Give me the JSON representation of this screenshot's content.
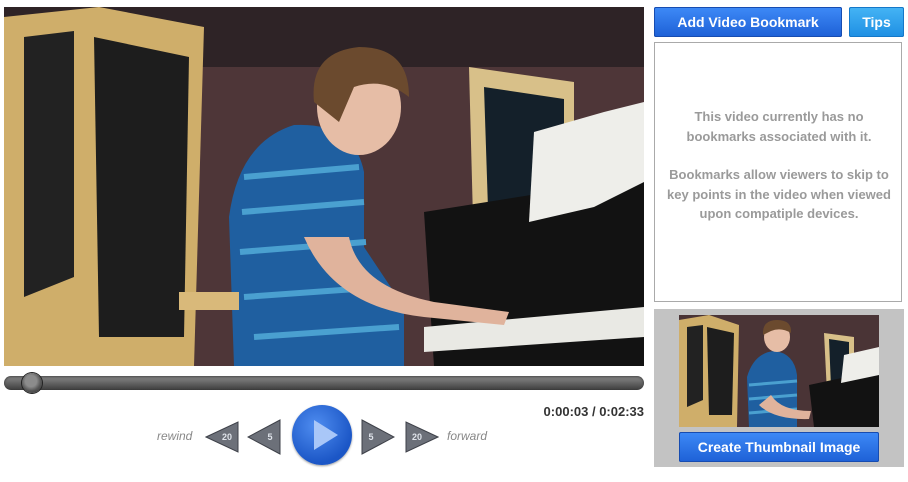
{
  "toolbar": {
    "add_bookmark_label": "Add Video Bookmark",
    "tips_label": "Tips"
  },
  "bookmarks": {
    "empty_message_line1": "This video currently has no bookmarks associated with it.",
    "empty_message_line2": "Bookmarks allow viewers to skip to key points in the video when viewed upon compatiple devices."
  },
  "thumbnail": {
    "create_label": "Create Thumbnail Image"
  },
  "player": {
    "progress_fraction": 0.02,
    "current_time": "0:00:03",
    "duration": "0:02:33",
    "time_display": "0:00:03 / 0:02:33",
    "rewind_label": "rewind",
    "forward_label": "forward",
    "rewind_20": "20",
    "rewind_5": "5",
    "forward_5": "5",
    "forward_20": "20"
  },
  "icons": {
    "play": "play-icon",
    "rewind": "rewind-triangle-icon",
    "forward": "forward-triangle-icon"
  },
  "colors": {
    "button_blue": "#1d60d6",
    "button_light_blue": "#1e8fe3",
    "play_blue": "#1b56c6",
    "message_gray": "#9a9a9a"
  }
}
